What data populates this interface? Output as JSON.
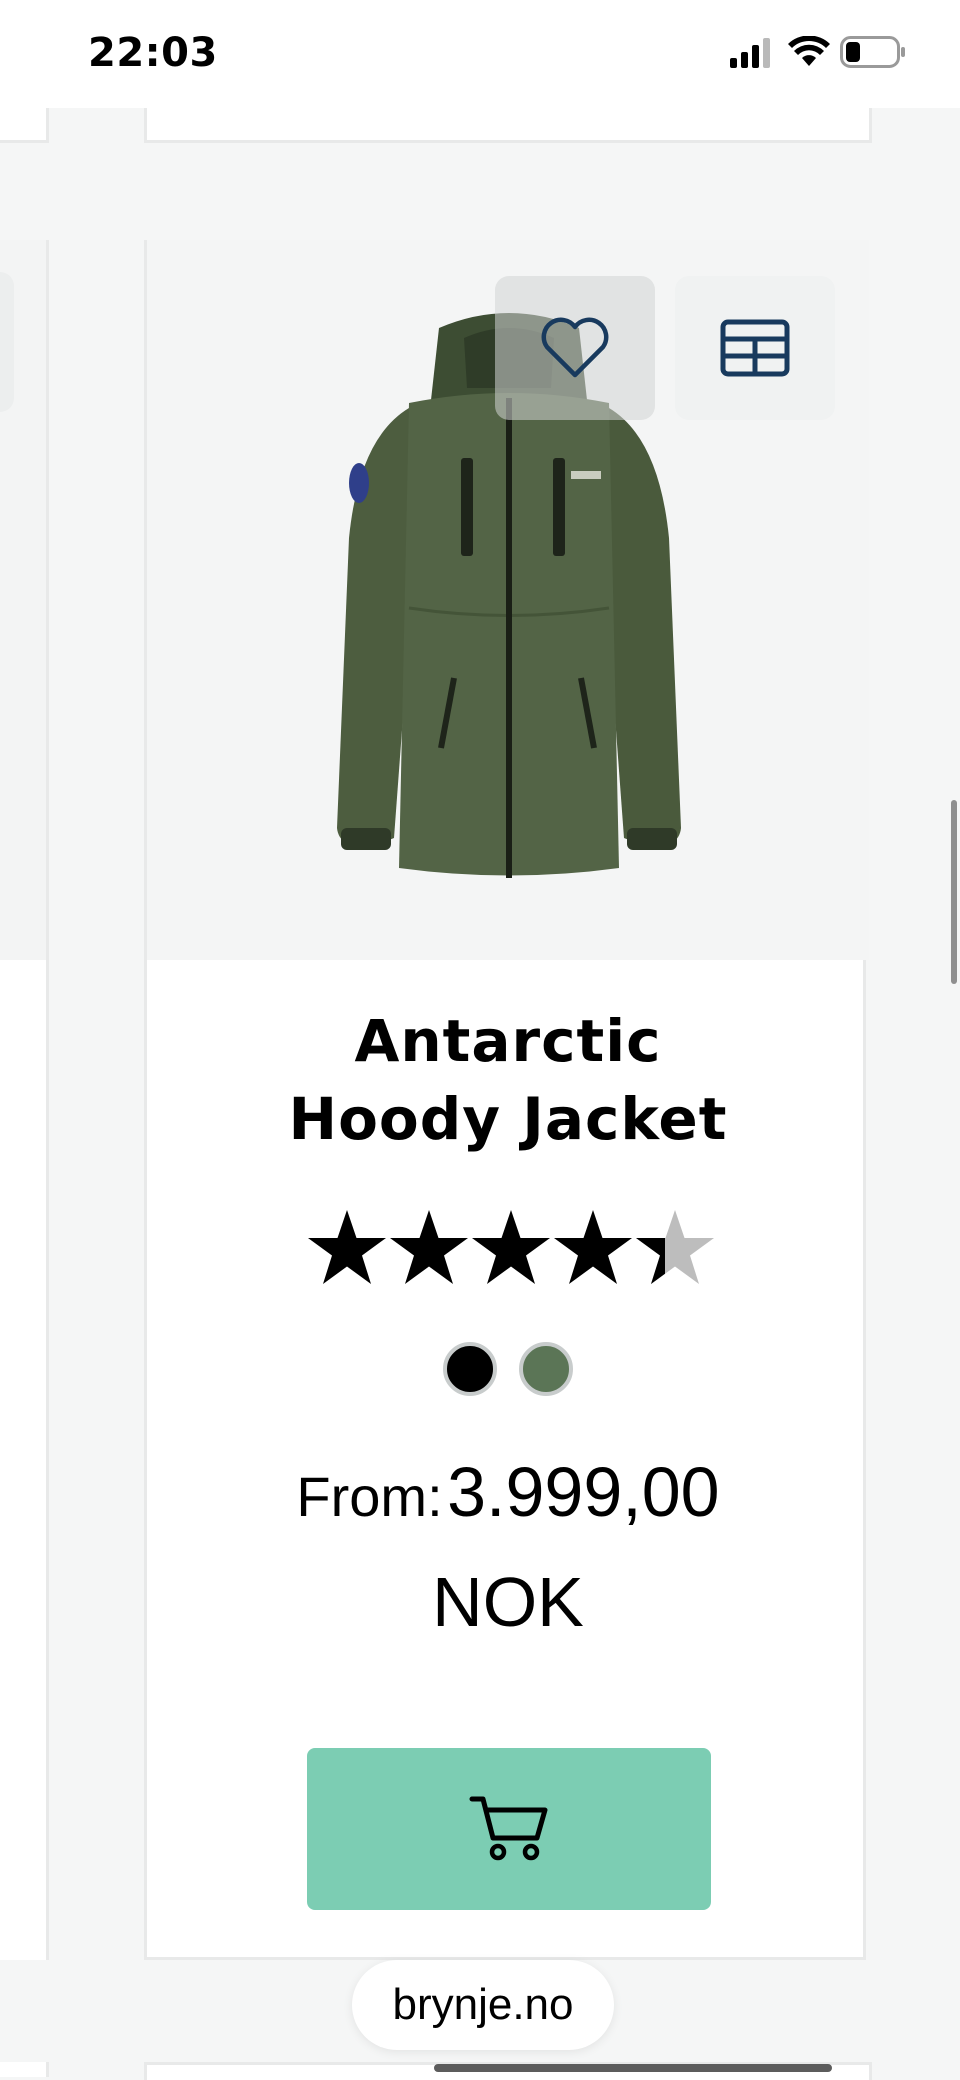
{
  "status_bar": {
    "time": "22:03",
    "icons": [
      "cellular-signal-icon",
      "wifi-icon",
      "battery-icon"
    ]
  },
  "product": {
    "name": "Antarctic Hoody Jacket",
    "name_lines": [
      "Antarctic",
      "Hoody Jacket"
    ],
    "rating": 4.5,
    "rating_max": 5,
    "colors": [
      "#000000",
      "#5b7556"
    ],
    "price_prefix": "From:",
    "price_amount": "3.999,00",
    "currency": "NOK",
    "image_icon": "jacket-image",
    "wishlist_icon": "heart-icon",
    "compare_icon": "table-icon",
    "cart_icon": "cart-icon"
  },
  "browser": {
    "url": "brynje.no"
  },
  "colors": {
    "cart_button": "#7ccdb3",
    "icon_navy": "#183a5e"
  }
}
